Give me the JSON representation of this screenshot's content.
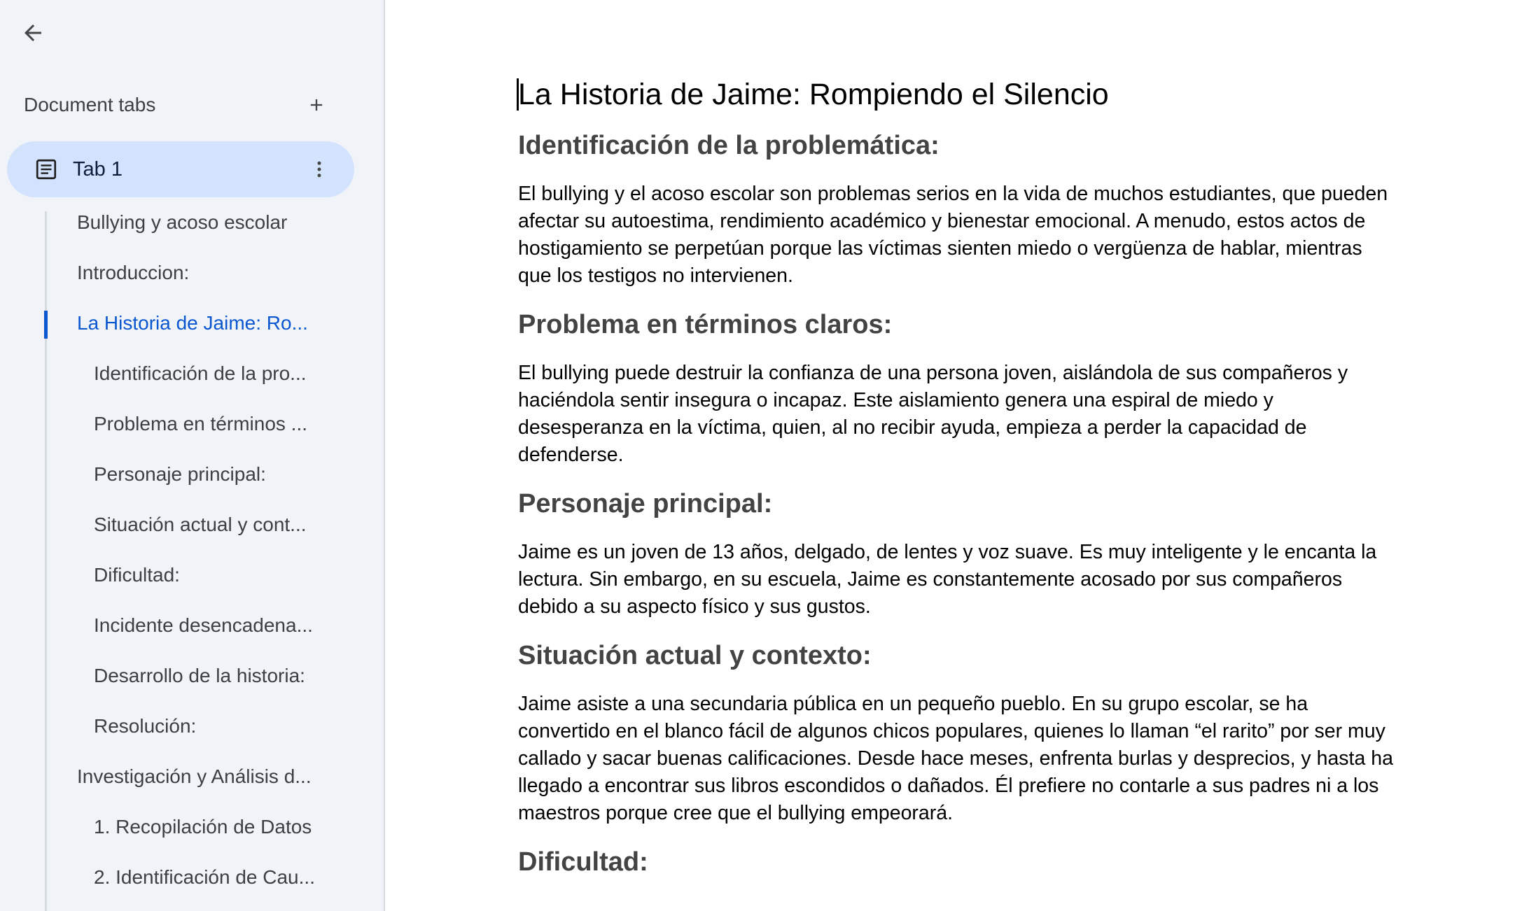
{
  "sidebar": {
    "back_icon": "arrow-left-icon",
    "tabs_title": "Document tabs",
    "add_icon": "plus-icon",
    "active_tab": {
      "label": "Tab 1",
      "icon": "document-icon",
      "more_icon": "more-vert-icon"
    },
    "outline": [
      {
        "label": "Bullying y acoso escolar",
        "level": 1,
        "active": false
      },
      {
        "label": "Introduccion:",
        "level": 1,
        "active": false
      },
      {
        "label": "La Historia de Jaime: Ro...",
        "level": 1,
        "active": true
      },
      {
        "label": "Identificación de la pro...",
        "level": 2,
        "active": false
      },
      {
        "label": "Problema en términos ...",
        "level": 2,
        "active": false
      },
      {
        "label": "Personaje principal:",
        "level": 2,
        "active": false
      },
      {
        "label": "Situación actual y cont...",
        "level": 2,
        "active": false
      },
      {
        "label": "Dificultad:",
        "level": 2,
        "active": false
      },
      {
        "label": "Incidente desencadena...",
        "level": 2,
        "active": false
      },
      {
        "label": "Desarrollo de la historia:",
        "level": 2,
        "active": false
      },
      {
        "label": "Resolución:",
        "level": 2,
        "active": false
      },
      {
        "label": "Investigación y Análisis d...",
        "level": 1,
        "active": false
      },
      {
        "label": "1. Recopilación de Datos",
        "level": 2,
        "active": false
      },
      {
        "label": "2. Identificación de Cau...",
        "level": 2,
        "active": false
      }
    ]
  },
  "document": {
    "title": "La Historia de Jaime: Rompiendo el Silencio",
    "sections": [
      {
        "heading": "Identificación de la problemática:",
        "body": "El bullying y el acoso escolar son problemas serios en la vida de muchos estudiantes, que pueden afectar su autoestima, rendimiento académico y bienestar emocional. A menudo, estos actos de hostigamiento se perpetúan porque las víctimas sienten miedo o vergüenza de hablar, mientras que los testigos no intervienen."
      },
      {
        "heading": "Problema en términos claros:",
        "body": "El bullying puede destruir la confianza de una persona joven, aislándola de sus compañeros y haciéndola sentir insegura o incapaz. Este aislamiento genera una espiral de miedo y desesperanza en la víctima, quien, al no recibir ayuda, empieza a perder la capacidad de defenderse."
      },
      {
        "heading": "Personaje principal:",
        "body": "Jaime es un joven de 13 años, delgado, de lentes y voz suave. Es muy inteligente y le encanta la lectura. Sin embargo, en su escuela, Jaime es constantemente acosado por sus compañeros debido a su aspecto físico y sus gustos."
      },
      {
        "heading": "Situación actual y contexto:",
        "body": "Jaime asiste a una secundaria pública en un pequeño pueblo. En su grupo escolar, se ha convertido en el blanco fácil de algunos chicos populares, quienes lo llaman “el rarito” por ser muy callado y sacar buenas calificaciones. Desde hace meses, enfrenta burlas y desprecios, y hasta ha llegado a encontrar sus libros escondidos o dañados. Él prefiere no contarle a sus padres ni a los maestros porque cree que el bullying empeorará."
      },
      {
        "heading": "Dificultad:",
        "body": ""
      }
    ]
  },
  "colors": {
    "sidebar_bg": "#f0f4f9",
    "active_tab_bg": "#d3e3fd",
    "accent": "#0b57d0",
    "heading": "#434343"
  }
}
